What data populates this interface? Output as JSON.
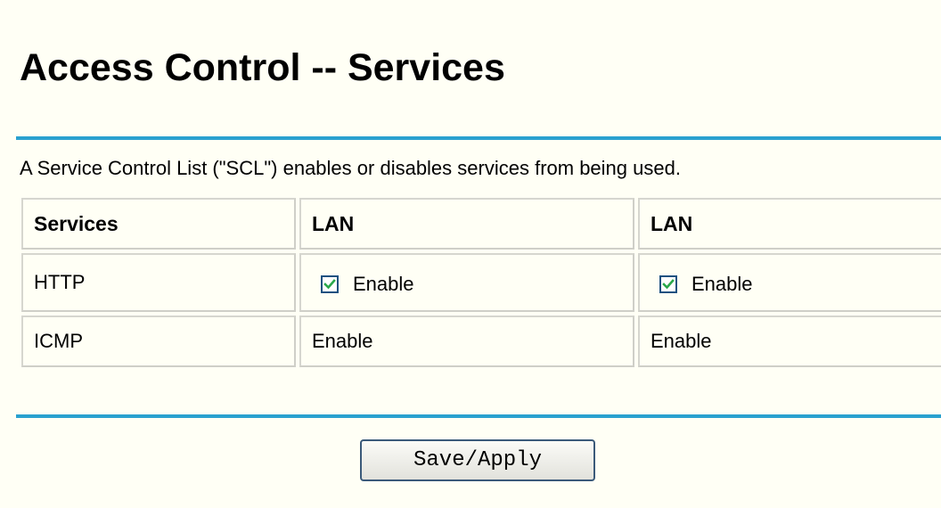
{
  "page": {
    "title": "Access Control -- Services",
    "description": "A Service Control List (\"SCL\") enables or disables services from being used."
  },
  "table": {
    "headers": [
      "Services",
      "LAN",
      "LAN"
    ],
    "rows": [
      {
        "service": "HTTP",
        "cells": [
          {
            "type": "checkbox",
            "checked": true,
            "label": "Enable"
          },
          {
            "type": "checkbox",
            "checked": true,
            "label": "Enable"
          }
        ]
      },
      {
        "service": "ICMP",
        "cells": [
          {
            "type": "text",
            "label": "Enable"
          },
          {
            "type": "text",
            "label": "Enable"
          }
        ]
      }
    ]
  },
  "actions": {
    "save_label": "Save/Apply"
  },
  "colors": {
    "background": "#fffff5",
    "divider": "#2aa1cf",
    "checkbox_border": "#1c5180",
    "checkmark": "#2aa84a"
  }
}
